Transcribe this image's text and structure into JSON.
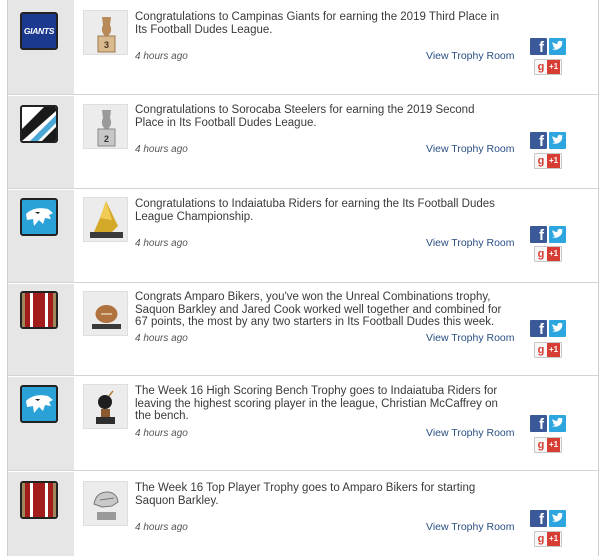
{
  "feed": {
    "items": [
      {
        "team_icon": "giants-logo-icon",
        "team_text": "GIANTS",
        "trophy_icon": "third-place-trophy-icon",
        "trophy_label": "3",
        "message": "Congratulations to Campinas Giants for earning the 2019 Third Place in Its Football Dudes League.",
        "time": "4 hours ago",
        "link": "View Trophy Room",
        "gplus": "+1"
      },
      {
        "team_icon": "steelers-logo-icon",
        "trophy_icon": "second-place-trophy-icon",
        "trophy_label": "2",
        "message": "Congratulations to Sorocaba Steelers for earning the 2019 Second Place in Its Football Dudes League.",
        "time": "4 hours ago",
        "link": "View Trophy Room",
        "gplus": "+1"
      },
      {
        "team_icon": "riders-panther-logo-icon",
        "trophy_icon": "championship-trophy-icon",
        "message": "Congratulations to Indaiatuba Riders for earning the Its Football Dudes League Championship.",
        "time": "4 hours ago",
        "link": "View Trophy Room",
        "gplus": "+1"
      },
      {
        "team_icon": "bikers-stripes-logo-icon",
        "trophy_icon": "football-trophy-icon",
        "message": "Congrats Amparo Bikers, you've won the Unreal Combinations trophy, Saquon Barkley and Jared Cook worked well together and combined for 67 points, the most by any two starters in Its Football Dudes this week.",
        "time": "4 hours ago",
        "link": "View Trophy Room",
        "gplus": "+1"
      },
      {
        "team_icon": "riders-panther-logo-icon",
        "trophy_icon": "bomb-trophy-icon",
        "message": "The Week 16 High Scoring Bench Trophy goes to Indaiatuba Riders for leaving the highest scoring player in the league, Christian McCaffrey on the bench.",
        "time": "4 hours ago",
        "link": "View Trophy Room",
        "gplus": "+1"
      },
      {
        "team_icon": "bikers-stripes-logo-icon",
        "trophy_icon": "top-player-helmet-trophy-icon",
        "message": "The Week 16 Top Player Trophy goes to Amparo Bikers for starting Saquon Barkley.",
        "time": "4 hours ago",
        "link": "View Trophy Room",
        "gplus": "+1"
      }
    ]
  }
}
